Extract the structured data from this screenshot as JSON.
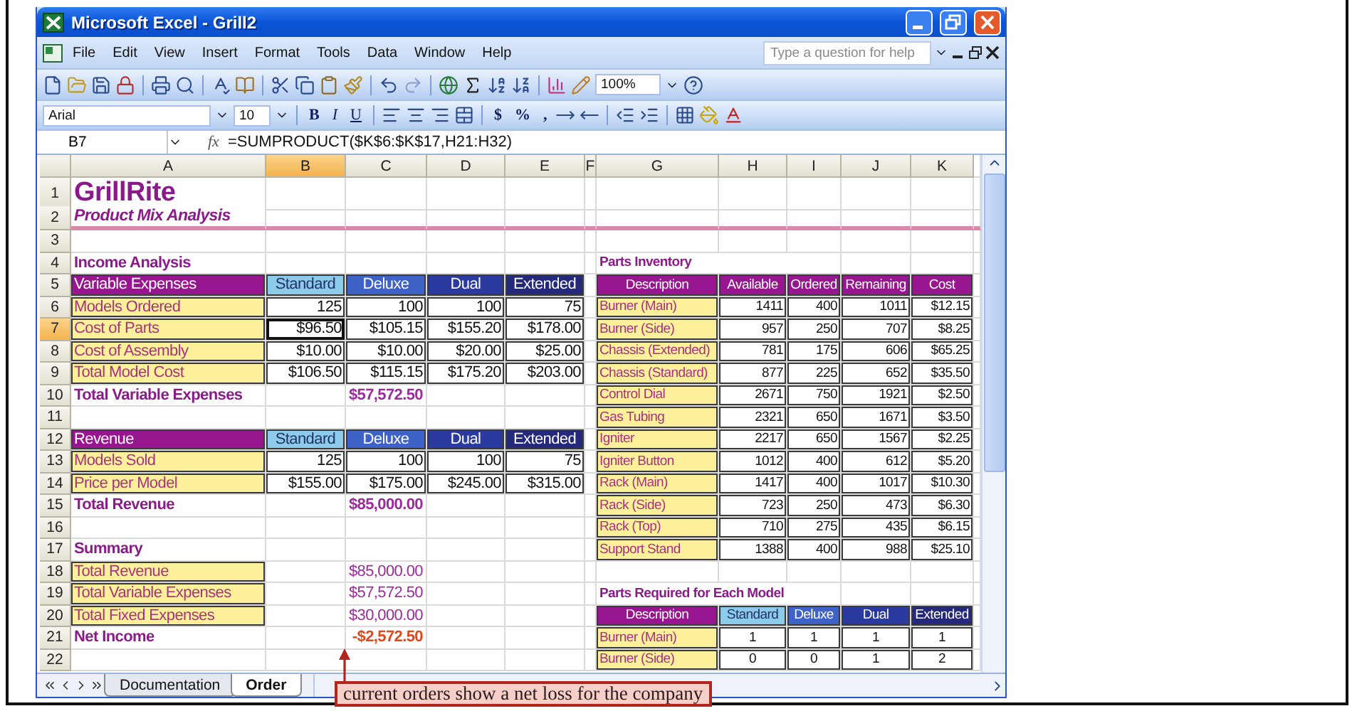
{
  "window": {
    "title": "Microsoft Excel - Grill2"
  },
  "menu": [
    "File",
    "Edit",
    "View",
    "Insert",
    "Format",
    "Tools",
    "Data",
    "Window",
    "Help"
  ],
  "help_box": {
    "placeholder": "Type a question for help"
  },
  "zoom": {
    "value": "100%"
  },
  "font": {
    "name": "Arial",
    "size": "10"
  },
  "style_buttons": [
    "B",
    "I",
    "U"
  ],
  "number_buttons": [
    "$",
    "%",
    ","
  ],
  "formula_bar": {
    "name_box": "B7",
    "function_symbol": "fx",
    "formula": "=SUMPRODUCT($K$6:$K$17,H21:H32)"
  },
  "columns": [
    {
      "label": "A",
      "selected": false
    },
    {
      "label": "B",
      "selected": true
    },
    {
      "label": "C",
      "selected": false
    },
    {
      "label": "D",
      "selected": false
    },
    {
      "label": "E",
      "selected": false
    },
    {
      "label": "F",
      "selected": false
    },
    {
      "label": "G",
      "selected": false
    },
    {
      "label": "H",
      "selected": false
    },
    {
      "label": "I",
      "selected": false
    },
    {
      "label": "J",
      "selected": false
    },
    {
      "label": "K",
      "selected": false
    }
  ],
  "rows": [
    {
      "number": "1",
      "selected": false,
      "cells": [
        {
          "text": "GrillRite",
          "kind": "title"
        },
        null,
        null,
        null,
        null,
        null,
        null,
        null,
        null,
        null,
        null
      ]
    },
    {
      "number": "2",
      "selected": false,
      "cells": [
        {
          "text": "Product Mix Analysis",
          "kind": "subtitle"
        },
        null,
        null,
        null,
        null,
        null,
        null,
        null,
        null,
        null,
        null
      ]
    },
    {
      "number": "3",
      "selected": false,
      "cells": [
        null,
        null,
        null,
        null,
        null,
        null,
        null,
        null,
        null,
        null,
        null
      ]
    },
    {
      "number": "4",
      "selected": false,
      "cells": [
        {
          "text": "Income Analysis",
          "kind": "section"
        },
        null,
        null,
        null,
        null,
        null,
        {
          "text": "Parts Inventory",
          "kind": "section"
        },
        null,
        null,
        null,
        null
      ]
    },
    {
      "number": "5",
      "selected": false,
      "cells": [
        {
          "text": "Variable Expenses",
          "kind": "header",
          "color": "#97168f"
        },
        {
          "text": "Standard",
          "kind": "header",
          "color": "#8ccbea"
        },
        {
          "text": "Deluxe",
          "kind": "header",
          "color": "#3f62c9"
        },
        {
          "text": "Dual",
          "kind": "header",
          "color": "#2b3a9f"
        },
        {
          "text": "Extended",
          "kind": "header",
          "color": "#25297b"
        },
        null,
        {
          "text": "Description",
          "kind": "header",
          "color": "#97168f"
        },
        {
          "text": "Available",
          "kind": "header",
          "color": "#97168f"
        },
        {
          "text": "Ordered",
          "kind": "header",
          "color": "#97168f"
        },
        {
          "text": "Remaining",
          "kind": "header",
          "color": "#97168f"
        },
        {
          "text": "Cost",
          "kind": "header",
          "color": "#97168f"
        }
      ]
    },
    {
      "number": "6",
      "selected": false,
      "cells": [
        {
          "text": "Models Ordered",
          "kind": "label"
        },
        {
          "text": "125",
          "kind": "value"
        },
        {
          "text": "100",
          "kind": "value"
        },
        {
          "text": "100",
          "kind": "value"
        },
        {
          "text": "75",
          "kind": "value"
        },
        null,
        {
          "text": "Burner (Main)",
          "kind": "label"
        },
        {
          "text": "1411",
          "kind": "value"
        },
        {
          "text": "400",
          "kind": "value"
        },
        {
          "text": "1011",
          "kind": "value"
        },
        {
          "text": "$12.15",
          "kind": "value"
        }
      ]
    },
    {
      "number": "7",
      "selected": true,
      "cells": [
        {
          "text": "Cost of Parts",
          "kind": "label"
        },
        {
          "text": "$96.50",
          "kind": "value"
        },
        {
          "text": "$105.15",
          "kind": "value"
        },
        {
          "text": "$155.20",
          "kind": "value"
        },
        {
          "text": "$178.00",
          "kind": "value"
        },
        null,
        {
          "text": "Burner (Side)",
          "kind": "label"
        },
        {
          "text": "957",
          "kind": "value"
        },
        {
          "text": "250",
          "kind": "value"
        },
        {
          "text": "707",
          "kind": "value"
        },
        {
          "text": "$8.25",
          "kind": "value"
        }
      ]
    },
    {
      "number": "8",
      "selected": false,
      "cells": [
        {
          "text": "Cost of Assembly",
          "kind": "label"
        },
        {
          "text": "$10.00",
          "kind": "value"
        },
        {
          "text": "$10.00",
          "kind": "value"
        },
        {
          "text": "$20.00",
          "kind": "value"
        },
        {
          "text": "$25.00",
          "kind": "value"
        },
        null,
        {
          "text": "Chassis (Extended)",
          "kind": "label"
        },
        {
          "text": "781",
          "kind": "value"
        },
        {
          "text": "175",
          "kind": "value"
        },
        {
          "text": "606",
          "kind": "value"
        },
        {
          "text": "$65.25",
          "kind": "value"
        }
      ]
    },
    {
      "number": "9",
      "selected": false,
      "cells": [
        {
          "text": "Total Model Cost",
          "kind": "label"
        },
        {
          "text": "$106.50",
          "kind": "value"
        },
        {
          "text": "$115.15",
          "kind": "value"
        },
        {
          "text": "$175.20",
          "kind": "value"
        },
        {
          "text": "$203.00",
          "kind": "value"
        },
        null,
        {
          "text": "Chassis (Standard)",
          "kind": "label"
        },
        {
          "text": "877",
          "kind": "value"
        },
        {
          "text": "225",
          "kind": "value"
        },
        {
          "text": "652",
          "kind": "value"
        },
        {
          "text": "$35.50",
          "kind": "value"
        }
      ]
    },
    {
      "number": "10",
      "selected": false,
      "cells": [
        {
          "text": "Total Variable Expenses",
          "kind": "totaltext"
        },
        null,
        {
          "text": "$57,572.50",
          "kind": "total"
        },
        null,
        null,
        null,
        {
          "text": "Control Dial",
          "kind": "label"
        },
        {
          "text": "2671",
          "kind": "value"
        },
        {
          "text": "750",
          "kind": "value"
        },
        {
          "text": "1921",
          "kind": "value"
        },
        {
          "text": "$2.50",
          "kind": "value"
        }
      ]
    },
    {
      "number": "11",
      "selected": false,
      "cells": [
        null,
        null,
        null,
        null,
        null,
        null,
        {
          "text": "Gas Tubing",
          "kind": "label"
        },
        {
          "text": "2321",
          "kind": "value"
        },
        {
          "text": "650",
          "kind": "value"
        },
        {
          "text": "1671",
          "kind": "value"
        },
        {
          "text": "$3.50",
          "kind": "value"
        }
      ]
    },
    {
      "number": "12",
      "selected": false,
      "cells": [
        {
          "text": "Revenue",
          "kind": "header",
          "color": "#97168f"
        },
        {
          "text": "Standard",
          "kind": "header",
          "color": "#8ccbea"
        },
        {
          "text": "Deluxe",
          "kind": "header",
          "color": "#3f62c9"
        },
        {
          "text": "Dual",
          "kind": "header",
          "color": "#2b3a9f"
        },
        {
          "text": "Extended",
          "kind": "header",
          "color": "#25297b"
        },
        null,
        {
          "text": "Igniter",
          "kind": "label"
        },
        {
          "text": "2217",
          "kind": "value"
        },
        {
          "text": "650",
          "kind": "value"
        },
        {
          "text": "1567",
          "kind": "value"
        },
        {
          "text": "$2.25",
          "kind": "value"
        }
      ]
    },
    {
      "number": "13",
      "selected": false,
      "cells": [
        {
          "text": "Models Sold",
          "kind": "label"
        },
        {
          "text": "125",
          "kind": "value"
        },
        {
          "text": "100",
          "kind": "value"
        },
        {
          "text": "100",
          "kind": "value"
        },
        {
          "text": "75",
          "kind": "value"
        },
        null,
        {
          "text": "Igniter Button",
          "kind": "label"
        },
        {
          "text": "1012",
          "kind": "value"
        },
        {
          "text": "400",
          "kind": "value"
        },
        {
          "text": "612",
          "kind": "value"
        },
        {
          "text": "$5.20",
          "kind": "value"
        }
      ]
    },
    {
      "number": "14",
      "selected": false,
      "cells": [
        {
          "text": "Price per Model",
          "kind": "label"
        },
        {
          "text": "$155.00",
          "kind": "value"
        },
        {
          "text": "$175.00",
          "kind": "value"
        },
        {
          "text": "$245.00",
          "kind": "value"
        },
        {
          "text": "$315.00",
          "kind": "value"
        },
        null,
        {
          "text": "Rack (Main)",
          "kind": "label"
        },
        {
          "text": "1417",
          "kind": "value"
        },
        {
          "text": "400",
          "kind": "value"
        },
        {
          "text": "1017",
          "kind": "value"
        },
        {
          "text": "$10.30",
          "kind": "value"
        }
      ]
    },
    {
      "number": "15",
      "selected": false,
      "cells": [
        {
          "text": "Total Revenue",
          "kind": "totaltext"
        },
        null,
        {
          "text": "$85,000.00",
          "kind": "total"
        },
        null,
        null,
        null,
        {
          "text": "Rack (Side)",
          "kind": "label"
        },
        {
          "text": "723",
          "kind": "value"
        },
        {
          "text": "250",
          "kind": "value"
        },
        {
          "text": "473",
          "kind": "value"
        },
        {
          "text": "$6.30",
          "kind": "value"
        }
      ]
    },
    {
      "number": "16",
      "selected": false,
      "cells": [
        null,
        null,
        null,
        null,
        null,
        null,
        {
          "text": "Rack (Top)",
          "kind": "label"
        },
        {
          "text": "710",
          "kind": "value"
        },
        {
          "text": "275",
          "kind": "value"
        },
        {
          "text": "435",
          "kind": "value"
        },
        {
          "text": "$6.15",
          "kind": "value"
        }
      ]
    },
    {
      "number": "17",
      "selected": false,
      "cells": [
        {
          "text": "Summary",
          "kind": "section"
        },
        null,
        null,
        null,
        null,
        null,
        {
          "text": "Support Stand",
          "kind": "label"
        },
        {
          "text": "1388",
          "kind": "value"
        },
        {
          "text": "400",
          "kind": "value"
        },
        {
          "text": "988",
          "kind": "value"
        },
        {
          "text": "$25.10",
          "kind": "value"
        }
      ]
    },
    {
      "number": "18",
      "selected": false,
      "cells": [
        {
          "text": "Total Revenue",
          "kind": "label"
        },
        null,
        {
          "text": "$85,000.00",
          "kind": "amount"
        },
        null,
        null,
        null,
        null,
        null,
        null,
        null,
        null
      ]
    },
    {
      "number": "19",
      "selected": false,
      "cells": [
        {
          "text": "Total Variable Expenses",
          "kind": "label"
        },
        null,
        {
          "text": "$57,572.50",
          "kind": "amount"
        },
        null,
        null,
        null,
        {
          "text": "Parts Required for Each Model",
          "kind": "section"
        },
        null,
        null,
        null,
        null
      ]
    },
    {
      "number": "20",
      "selected": false,
      "cells": [
        {
          "text": "Total Fixed Expenses",
          "kind": "label"
        },
        null,
        {
          "text": "$30,000.00",
          "kind": "amount"
        },
        null,
        null,
        null,
        {
          "text": "Description",
          "kind": "header",
          "color": "#97168f"
        },
        {
          "text": "Standard",
          "kind": "header",
          "color": "#8ccbea"
        },
        {
          "text": "Deluxe",
          "kind": "header",
          "color": "#3f62c9"
        },
        {
          "text": "Dual",
          "kind": "header",
          "color": "#2b3a9f"
        },
        {
          "text": "Extended",
          "kind": "header",
          "color": "#25297b"
        }
      ]
    },
    {
      "number": "21",
      "selected": false,
      "cells": [
        {
          "text": "Net Income",
          "kind": "totaltext"
        },
        null,
        {
          "text": "-$2,572.50",
          "kind": "loss"
        },
        null,
        null,
        null,
        {
          "text": "Burner (Main)",
          "kind": "label"
        },
        {
          "text": "1",
          "kind": "count"
        },
        {
          "text": "1",
          "kind": "count"
        },
        {
          "text": "1",
          "kind": "count"
        },
        {
          "text": "1",
          "kind": "count"
        }
      ]
    },
    {
      "number": "22",
      "selected": false,
      "cells": [
        null,
        null,
        null,
        null,
        null,
        null,
        {
          "text": "Burner (Side)",
          "kind": "label"
        },
        {
          "text": "0",
          "kind": "count"
        },
        {
          "text": "0",
          "kind": "count"
        },
        {
          "text": "1",
          "kind": "count"
        },
        {
          "text": "2",
          "kind": "count"
        }
      ]
    }
  ],
  "sheet_tabs": [
    {
      "label": "Documentation",
      "selected": false
    },
    {
      "label": "Order",
      "selected": true
    }
  ],
  "callout": {
    "text": "current orders show a net loss for the company"
  }
}
